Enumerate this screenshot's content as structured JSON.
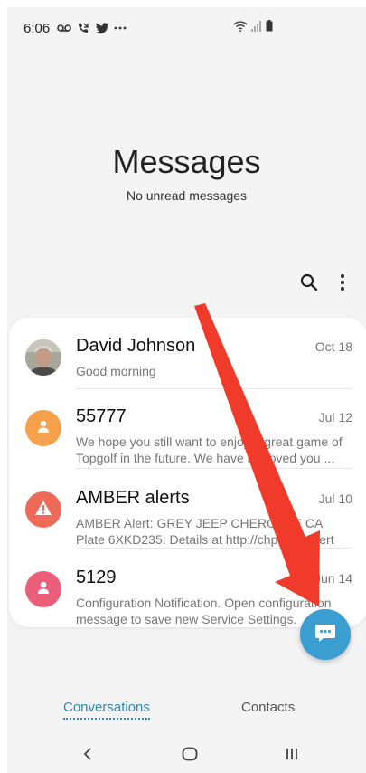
{
  "status_bar": {
    "time": "6:06",
    "icons": [
      "voicemail-icon",
      "missed-call-icon",
      "twitter-icon",
      "more-dots-icon"
    ],
    "right_icons": [
      "wifi-icon",
      "signal-icon",
      "battery-icon"
    ]
  },
  "header": {
    "title": "Messages",
    "subtitle": "No unread messages"
  },
  "toolbar": {
    "icons": [
      "search-icon",
      "more-options-icon"
    ]
  },
  "conversations": [
    {
      "name": "David Johnson",
      "date": "Oct 18",
      "preview": "Good morning",
      "avatar": "photo-avatar"
    },
    {
      "name": "55777",
      "date": "Jul 12",
      "preview": "We hope you still want to enjoy a great game of Topgolf in the future. We have removed you ...",
      "avatar": "person-avatar",
      "avatar_color": "#f5a04a"
    },
    {
      "name": "AMBER alerts",
      "date": "Jul 10",
      "preview": "AMBER Alert: GREY JEEP CHEROKEE CA Plate 6XKD235: Details at http://chp.click/alert",
      "avatar": "warning-avatar",
      "avatar_color": "#ec6a57"
    },
    {
      "name": "5129",
      "date": "Jun 14",
      "preview": "Configuration Notification. Open configuration message to save new Service Settings.",
      "avatar": "person-avatar",
      "avatar_color": "#ec5f7a"
    }
  ],
  "fab": {
    "icon": "compose-message-icon",
    "color": "#3a9fd0"
  },
  "annotation": {
    "icon": "red-arrow-icon",
    "color": "#f03a2a"
  },
  "tabs": {
    "conversations": "Conversations",
    "contacts": "Contacts",
    "active": "conversations"
  },
  "nav": {
    "icons": [
      "back-icon",
      "home-icon",
      "recents-icon"
    ]
  }
}
